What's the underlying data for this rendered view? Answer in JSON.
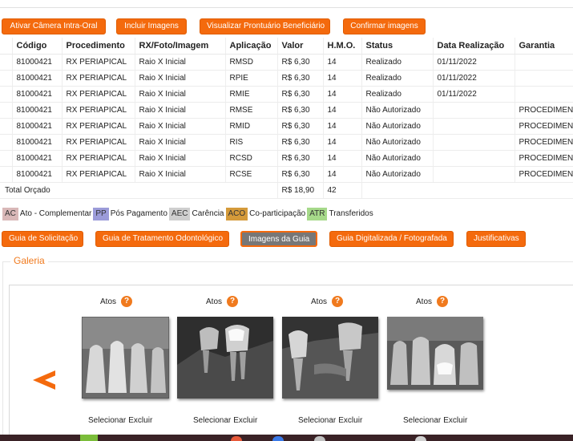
{
  "top_buttons": [
    "Ativar Câmera Intra-Oral",
    "Incluir Imagens",
    "Visualizar Prontuário Beneficiário",
    "Confirmar imagens"
  ],
  "table": {
    "headers": [
      "",
      "Código",
      "Procedimento",
      "RX/Foto/Imagem",
      "Aplicação",
      "Valor",
      "H.M.O.",
      "Status",
      "Data Realização",
      "Garantia"
    ],
    "rows": [
      [
        "",
        "81000421",
        "RX PERIAPICAL",
        "Raio X Inicial",
        "RMSD",
        "R$ 6,30",
        "14",
        "Realizado",
        "01/11/2022",
        ""
      ],
      [
        "",
        "81000421",
        "RX PERIAPICAL",
        "Raio X Inicial",
        "RPIE",
        "R$ 6,30",
        "14",
        "Realizado",
        "01/11/2022",
        ""
      ],
      [
        "",
        "81000421",
        "RX PERIAPICAL",
        "Raio X Inicial",
        "RMIE",
        "R$ 6,30",
        "14",
        "Realizado",
        "01/11/2022",
        ""
      ],
      [
        "",
        "81000421",
        "RX PERIAPICAL",
        "Raio X Inicial",
        "RMSE",
        "R$ 6,30",
        "14",
        "Não Autorizado",
        "",
        "PROCEDIMENTO"
      ],
      [
        "",
        "81000421",
        "RX PERIAPICAL",
        "Raio X Inicial",
        "RMID",
        "R$ 6,30",
        "14",
        "Não Autorizado",
        "",
        "PROCEDIMENTO"
      ],
      [
        "",
        "81000421",
        "RX PERIAPICAL",
        "Raio X Inicial",
        "RIS",
        "R$ 6,30",
        "14",
        "Não Autorizado",
        "",
        "PROCEDIMENTO"
      ],
      [
        "",
        "81000421",
        "RX PERIAPICAL",
        "Raio X Inicial",
        "RCSD",
        "R$ 6,30",
        "14",
        "Não Autorizado",
        "",
        "PROCEDIMENTO"
      ],
      [
        "",
        "81000421",
        "RX PERIAPICAL",
        "Raio X Inicial",
        "RCSE",
        "R$ 6,30",
        "14",
        "Não Autorizado",
        "",
        "PROCEDIMENTO"
      ]
    ],
    "total": {
      "label": "Total Orçado",
      "valor": "R$ 18,90",
      "hmo": "42"
    }
  },
  "legend": [
    {
      "code": "AC",
      "label": "Ato - Complementar",
      "color": "#d9b8b8"
    },
    {
      "code": "PP",
      "label": "Pós Pagamento",
      "color": "#9b9bd9"
    },
    {
      "code": "AEC",
      "label": "Carência",
      "color": "#cfcfcf"
    },
    {
      "code": "ACO",
      "label": "Co-participação",
      "color": "#d49a3a"
    },
    {
      "code": "ATR",
      "label": "Transferidos",
      "color": "#a6d98a"
    }
  ],
  "guide_buttons": [
    "Guia de Solicitação",
    "Guia de Tratamento Odontológico",
    "Imagens da Guia",
    "Guia Digitalizada / Fotografada",
    "Justificativas"
  ],
  "gallery": {
    "title": "Galeria",
    "items": [
      {
        "label": "Atos",
        "help": "?",
        "select": "Selecionar",
        "delete": "Excluir"
      },
      {
        "label": "Atos",
        "help": "?",
        "select": "Selecionar",
        "delete": "Excluir"
      },
      {
        "label": "Atos",
        "help": "?",
        "select": "Selecionar",
        "delete": "Excluir"
      },
      {
        "label": "Atos",
        "help": "?",
        "select": "Selecionar",
        "delete": "Excluir"
      }
    ],
    "prev_icon": "arrow-left-icon"
  },
  "colors": {
    "accent": "#f46a0d",
    "gallery_title": "#f07a1e"
  }
}
